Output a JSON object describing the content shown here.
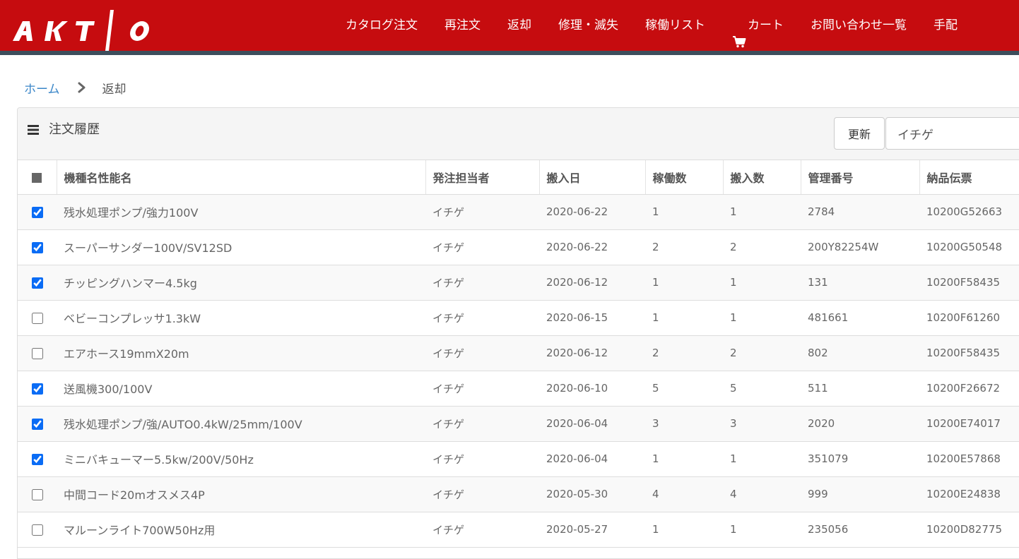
{
  "brand": {
    "logo_text": "AKTIO",
    "header_color": "#c60c0f",
    "header_stripe": "#3d4e5c"
  },
  "nav": {
    "items": [
      {
        "label": "カタログ注文"
      },
      {
        "label": "再注文"
      },
      {
        "label": "返却"
      },
      {
        "label": "修理・滅失"
      },
      {
        "label": "稼働リスト"
      },
      {
        "label": "カート",
        "icon": "cart-icon"
      },
      {
        "label": "お問い合わせ一覧"
      },
      {
        "label": "手配"
      }
    ]
  },
  "breadcrumb": {
    "home": "ホーム",
    "separator_icon": "chevron-right-icon",
    "current": "返却"
  },
  "panel": {
    "title": "注文履歴",
    "title_icon": "menu-icon",
    "refresh_label": "更新",
    "filter_value": "イチゲ"
  },
  "table": {
    "headers": [
      "機種名性能名",
      "発注担当者",
      "搬入日",
      "稼働数",
      "搬入数",
      "管理番号",
      "納品伝票"
    ],
    "rows": [
      {
        "checked": true,
        "cells": [
          "残水処理ポンプ/強力100V",
          "イチゲ",
          "2020-06-22",
          "1",
          "1",
          "2784",
          "10200G52663"
        ]
      },
      {
        "checked": true,
        "cells": [
          "スーパーサンダー100V/SV12SD",
          "イチゲ",
          "2020-06-22",
          "2",
          "2",
          "200Y82254W",
          "10200G50548"
        ]
      },
      {
        "checked": true,
        "cells": [
          "チッピングハンマー4.5kg",
          "イチゲ",
          "2020-06-12",
          "1",
          "1",
          "131",
          "10200F58435"
        ]
      },
      {
        "checked": false,
        "cells": [
          "ベビーコンプレッサ1.3kW",
          "イチゲ",
          "2020-06-15",
          "1",
          "1",
          "481661",
          "10200F61260"
        ]
      },
      {
        "checked": false,
        "cells": [
          "エアホース19mmX20m",
          "イチゲ",
          "2020-06-12",
          "2",
          "2",
          "802",
          "10200F58435"
        ]
      },
      {
        "checked": true,
        "cells": [
          "送風機300/100V",
          "イチゲ",
          "2020-06-10",
          "5",
          "5",
          "511",
          "10200F26672"
        ]
      },
      {
        "checked": true,
        "cells": [
          "残水処理ポンプ/強/AUTO0.4kW/25mm/100V",
          "イチゲ",
          "2020-06-04",
          "3",
          "3",
          "2020",
          "10200E74017"
        ]
      },
      {
        "checked": true,
        "cells": [
          "ミニバキューマー5.5kw/200V/50Hz",
          "イチゲ",
          "2020-06-04",
          "1",
          "1",
          "351079",
          "10200E57868"
        ]
      },
      {
        "checked": false,
        "cells": [
          "中間コード20mオスメス4P",
          "イチゲ",
          "2020-05-30",
          "4",
          "4",
          "999",
          "10200E24838"
        ]
      },
      {
        "checked": false,
        "cells": [
          "マルーンライト700W50Hz用",
          "イチゲ",
          "2020-05-27",
          "1",
          "1",
          "235056",
          "10200D82775"
        ]
      }
    ]
  }
}
